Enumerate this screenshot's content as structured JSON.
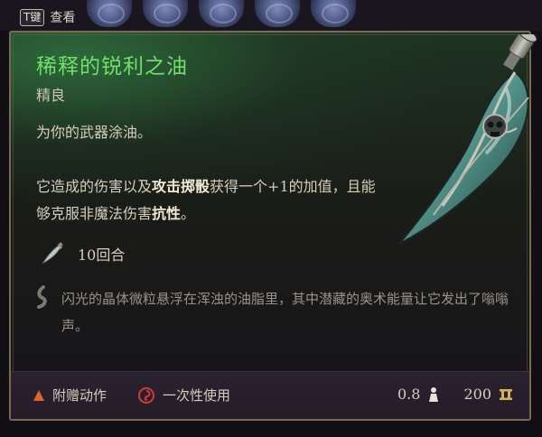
{
  "top_bar": {
    "key_label": "T键",
    "view_label": "查看"
  },
  "item": {
    "name": "稀释的锐利之油",
    "rarity": "精良",
    "description_line1": "为你的武器涂油。",
    "description_part1": "它造成的伤害以及",
    "description_highlight1": "攻击掷骰",
    "description_part2": "获得一个+1的加值，且能够克服非魔法伤害",
    "description_highlight2": "抗性",
    "description_part3": "。",
    "duration": "10回合",
    "flavor_text": "闪光的晶体微粒悬浮在浑浊的油脂里，其中潜藏的奥术能量让它发出了嗡嗡声。"
  },
  "footer": {
    "action_type": "附赠动作",
    "usage": "一次性使用",
    "weight": "0.8",
    "value": "200"
  },
  "colors": {
    "title_green": "#6fe06a",
    "border_gold": "#7b6a52",
    "action_orange": "#e0632a",
    "usage_red": "#d23a32",
    "coin_gold": "#d9b24a"
  },
  "icons": {
    "duration": "oil-vial-icon",
    "flavor": "quote-mark-icon",
    "action": "bonus-action-triangle-icon",
    "usage": "single-use-swirl-icon",
    "weight": "weight-icon",
    "value": "gold-coin-icon"
  }
}
